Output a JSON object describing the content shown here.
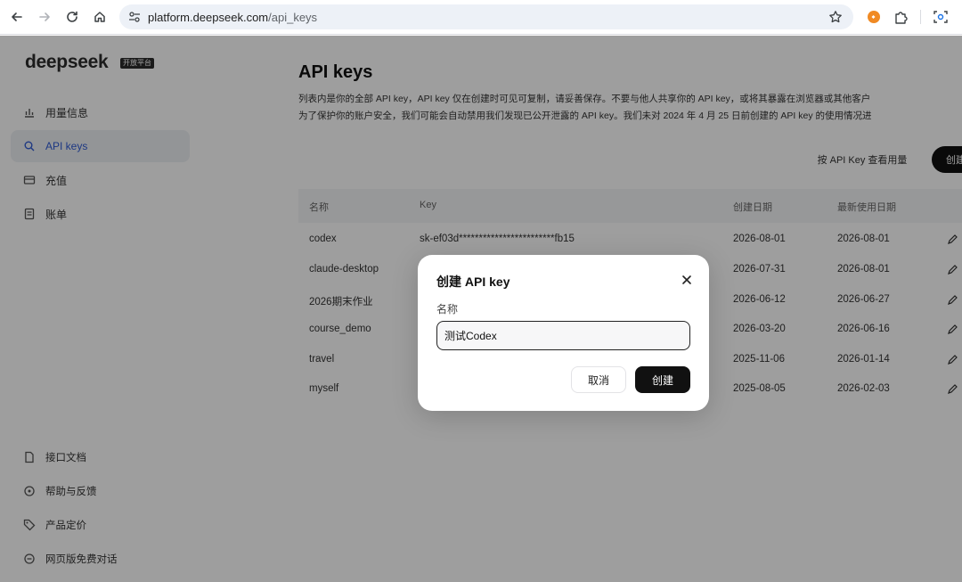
{
  "browser": {
    "url_host": "platform.deepseek.com",
    "url_path": "/api_keys",
    "icons": [
      "back-icon",
      "forward-icon",
      "reload-icon",
      "home-icon",
      "site-settings-icon",
      "bookmark-star-icon",
      "extension-icon",
      "puzzle-icon",
      "screenshot-icon"
    ]
  },
  "sidebar": {
    "logo": "deepseek",
    "logo_badge": "开放平台",
    "items": [
      {
        "label": "用量信息",
        "icon": "bar-chart-icon"
      },
      {
        "label": "API keys",
        "icon": "search-key-icon",
        "active": true
      },
      {
        "label": "充值",
        "icon": "wallet-icon"
      },
      {
        "label": "账单",
        "icon": "bill-icon"
      }
    ],
    "bottom_items": [
      {
        "label": "接口文档",
        "icon": "document-icon"
      },
      {
        "label": "帮助与反馈",
        "icon": "help-icon"
      },
      {
        "label": "产品定价",
        "icon": "price-tag-icon"
      },
      {
        "label": "网页版免费对话",
        "icon": "chat-icon"
      }
    ]
  },
  "main": {
    "title": "API keys",
    "desc_line1": "列表内是你的全部 API key，API key 仅在创建时可见可复制，请妥善保存。不要与他人共享你的 API key，或将其暴露在浏览器或其他客户",
    "desc_line2": "为了保护你的账户安全，我们可能会自动禁用我们发现已公开泄露的 API key。我们未对 2024 年 4 月 25 日前创建的 API key 的使用情况进",
    "usage_button": "按 API Key 查看用量",
    "create_button": "创建",
    "table": {
      "headers": [
        "名称",
        "Key",
        "创建日期",
        "最新使用日期"
      ],
      "rows": [
        {
          "name": "codex",
          "key": "sk-ef03d************************fb15",
          "created": "2026-08-01",
          "last_used": "2026-08-01"
        },
        {
          "name": "claude-desktop",
          "key": "",
          "created": "2026-07-31",
          "last_used": "2026-08-01"
        },
        {
          "name": "2026期末作业",
          "key": "",
          "created": "2026-06-12",
          "last_used": "2026-06-27"
        },
        {
          "name": "course_demo",
          "key": "",
          "created": "2026-03-20",
          "last_used": "2026-06-16"
        },
        {
          "name": "travel",
          "key": "",
          "created": "2025-11-06",
          "last_used": "2026-01-14"
        },
        {
          "name": "myself",
          "key": "",
          "created": "2025-08-05",
          "last_used": "2026-02-03"
        }
      ]
    }
  },
  "modal": {
    "title": "创建 API key",
    "field_label": "名称",
    "input_value": "测试Codex",
    "cancel_label": "取消",
    "confirm_label": "创建"
  }
}
